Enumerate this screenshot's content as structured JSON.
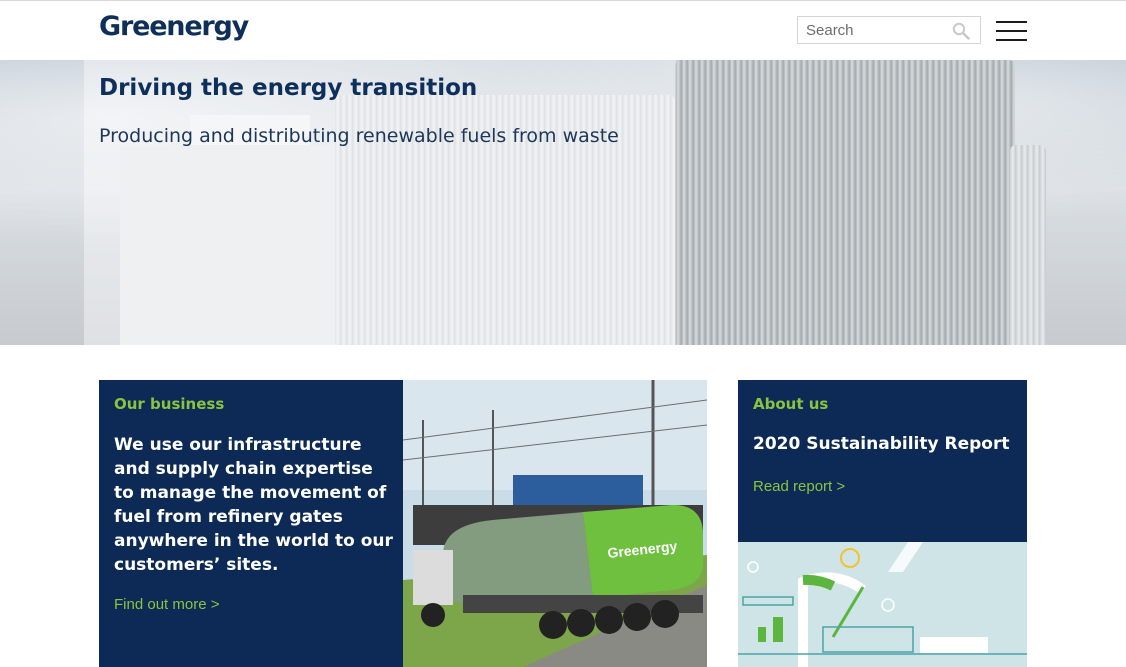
{
  "header": {
    "logo_text": "Greenergy",
    "search_placeholder": "Search"
  },
  "hero": {
    "title": "Driving the energy transition",
    "subtitle": "Producing and distributing renewable fuels from waste"
  },
  "business_card": {
    "eyebrow": "Our business",
    "text": "We use our infrastructure and supply chain expertise to manage the movement of fuel from refinery gates anywhere in the world to our customers’ sites.",
    "link": "Find out more >"
  },
  "truck_image": {
    "tanker_label": "Greenergy"
  },
  "about_card": {
    "eyebrow": "About us",
    "title": "2020 Sustainability Report",
    "link": "Read report >"
  },
  "colors": {
    "navy": "#0c2a55",
    "brand_green": "#8ac43f",
    "logo": "#0e2f5a"
  },
  "icons": {
    "search": "search-icon",
    "menu": "hamburger-menu-icon"
  }
}
